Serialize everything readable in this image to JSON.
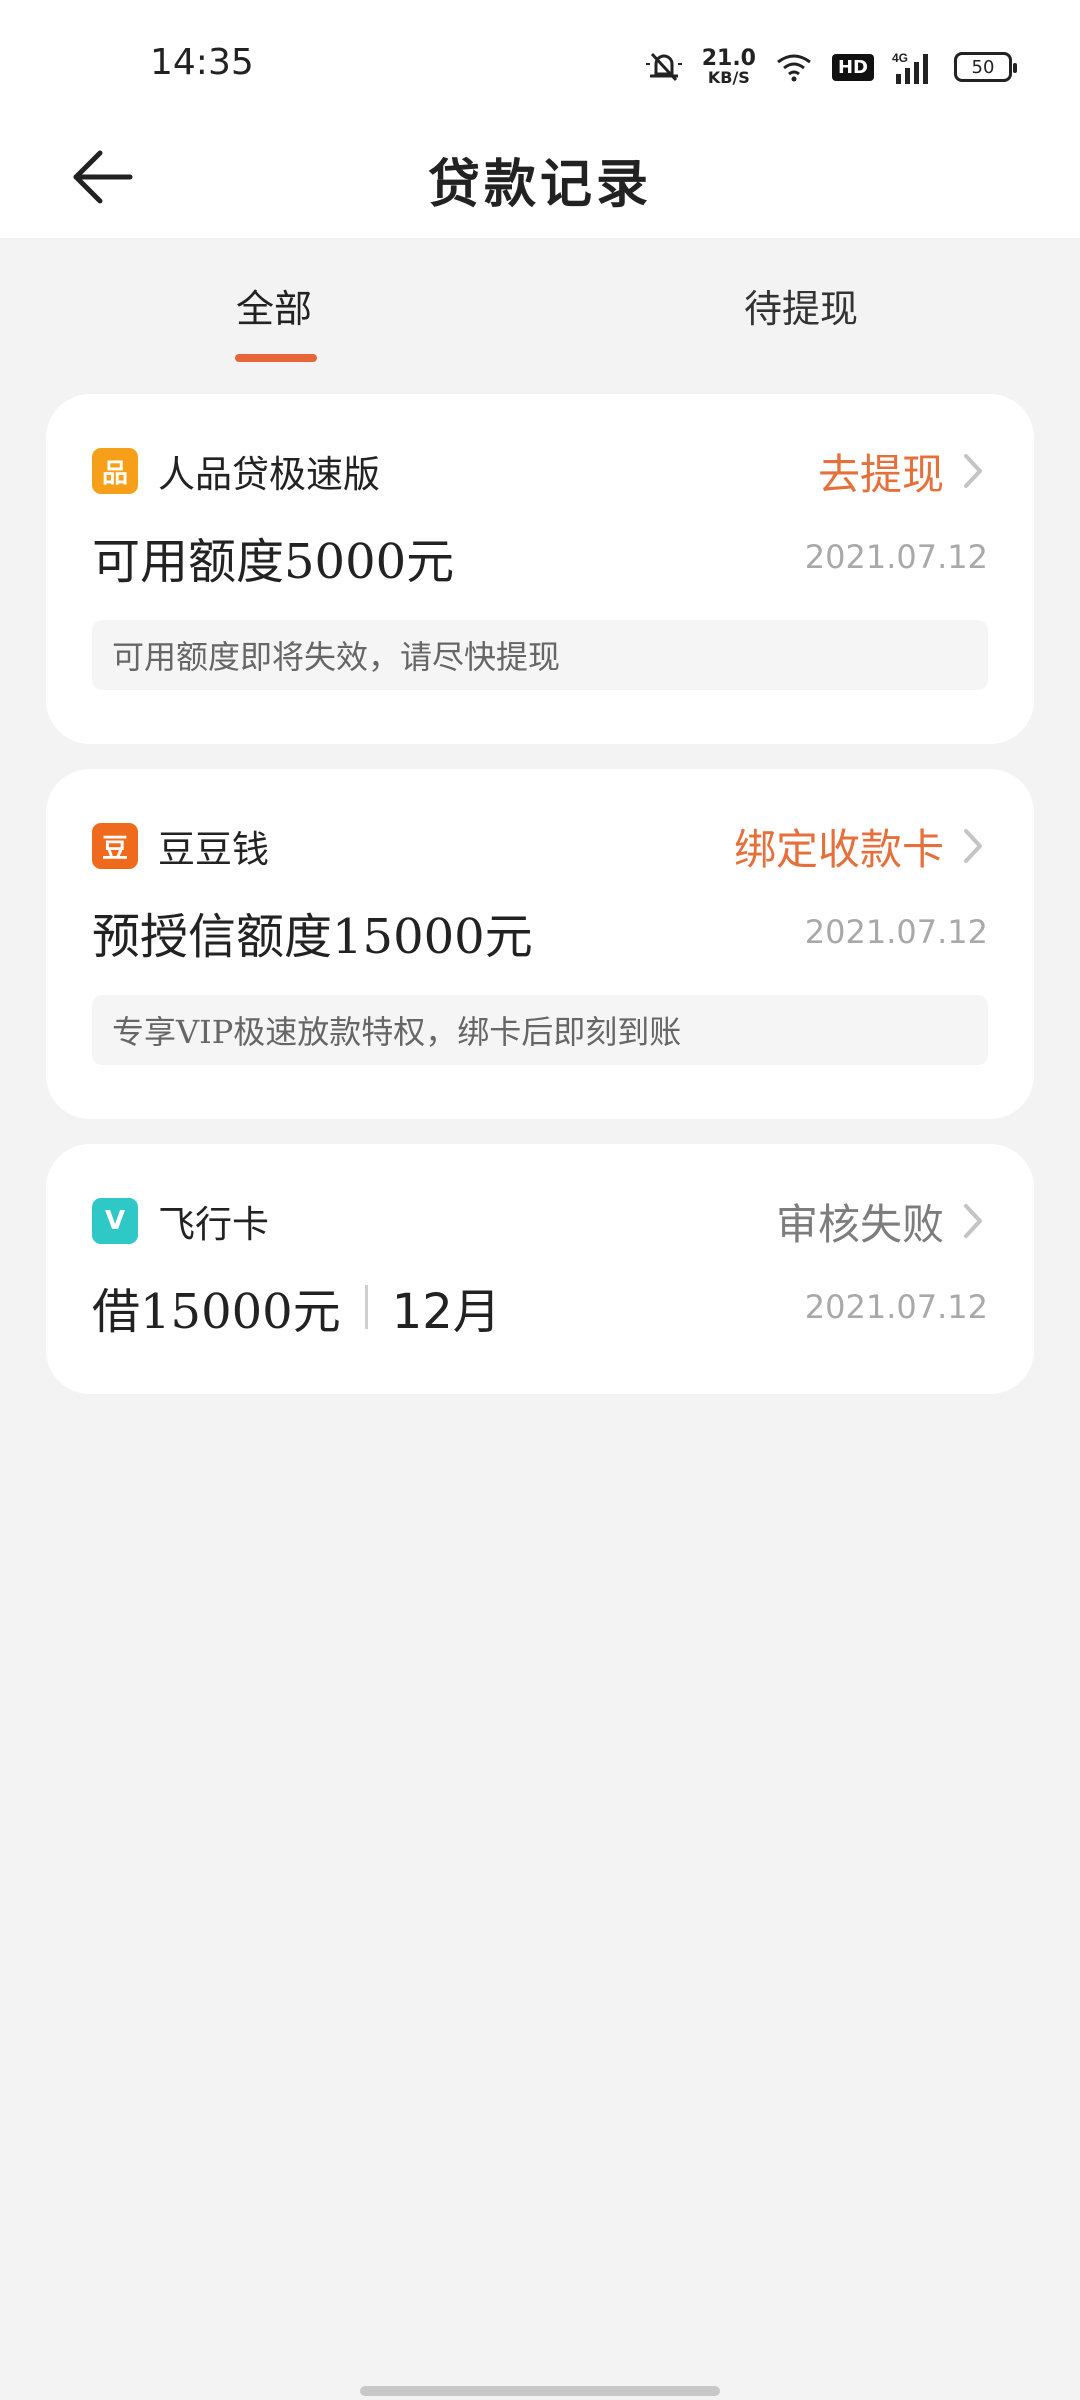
{
  "status_bar": {
    "time": "14:35",
    "net_speed_value": "21.0",
    "net_speed_unit": "KB/S",
    "hd_label": "HD",
    "network_label": "4G",
    "battery": "50"
  },
  "header": {
    "title": "贷款记录",
    "back_icon": "back-arrow-icon"
  },
  "tabs": [
    {
      "label": "全部",
      "active": true
    },
    {
      "label": "待提现",
      "active": false
    }
  ],
  "records": [
    {
      "app_name": "人品贷极速版",
      "icon_glyph": "品",
      "icon_color": "#f6a01a",
      "action": "去提现",
      "action_color": "#e5703b",
      "amount": "可用额度5000元",
      "date": "2021.07.12",
      "notice": "可用额度即将失效，请尽快提现"
    },
    {
      "app_name": "豆豆钱",
      "icon_glyph": "豆",
      "icon_color": "#f06a1e",
      "action": "绑定收款卡",
      "action_color": "#e5703b",
      "amount": "预授信额度15000元",
      "date": "2021.07.12",
      "notice": "专享VIP极速放款特权，绑卡后即刻到账"
    },
    {
      "app_name": "飞行卡",
      "icon_glyph": "V",
      "icon_color": "#2ec9c6",
      "action": "审核失败",
      "action_color": "#7d7d7d",
      "amount": "借15000元",
      "term": "12月",
      "date": "2021.07.12"
    }
  ],
  "colors": {
    "accent": "#e8653a",
    "background": "#f3f3f3",
    "card": "#ffffff"
  }
}
